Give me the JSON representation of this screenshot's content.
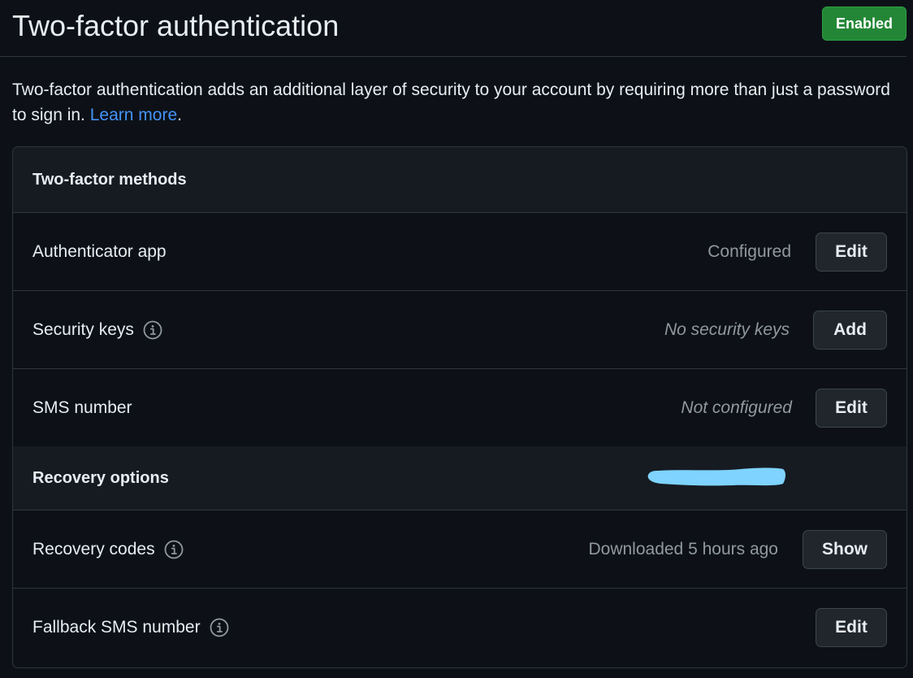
{
  "header": {
    "title": "Two-factor authentication",
    "status_badge": "Enabled"
  },
  "description": {
    "text": "Two-factor authentication adds an additional layer of security to your account by requiring more than just a password to sign in. ",
    "link": "Learn more",
    "suffix": "."
  },
  "methods_section": {
    "title": "Two-factor methods",
    "items": [
      {
        "label": "Authenticator app",
        "status": "Configured",
        "action": "Edit"
      },
      {
        "label": "Security keys",
        "status": "No security keys",
        "action": "Add",
        "icon": "info-icon"
      },
      {
        "label": "SMS number",
        "status": "Not configured",
        "action": "Edit"
      }
    ]
  },
  "recovery_section": {
    "title": "Recovery options",
    "items": [
      {
        "label": "Recovery codes",
        "status": "Downloaded 5 hours ago",
        "action": "Show",
        "icon": "info-icon"
      },
      {
        "label": "Fallback SMS number",
        "status": "",
        "action": "Edit",
        "icon": "info-icon"
      }
    ]
  },
  "colors": {
    "background": "#0d1117",
    "section_header_bg": "#161b22",
    "border": "#30363d",
    "badge_green": "#238636",
    "link_blue": "#4493f8",
    "muted_text": "#9198a1",
    "redaction_blue": "#7fd3ff"
  }
}
